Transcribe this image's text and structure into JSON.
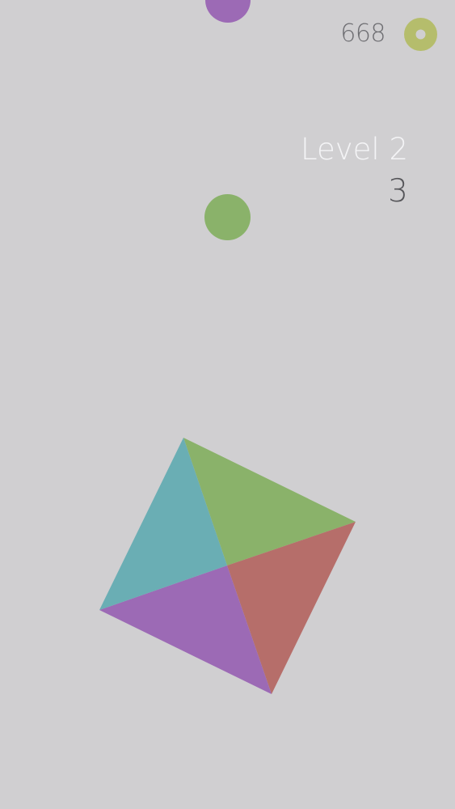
{
  "hud": {
    "coins": "668",
    "coin_icon": "coin-ring-icon",
    "level_label": "Level 2",
    "score": "3"
  },
  "colors": {
    "background": "#d0cfd1",
    "purple": "#9c6ab5",
    "green": "#8ab26a",
    "teal": "#6aaeb4",
    "red": "#b66e6a",
    "coin": "#b5bd6c"
  },
  "balls": [
    {
      "color": "purple"
    },
    {
      "color": "green"
    }
  ],
  "rotator": {
    "segments": [
      "green",
      "red",
      "purple",
      "teal"
    ]
  }
}
